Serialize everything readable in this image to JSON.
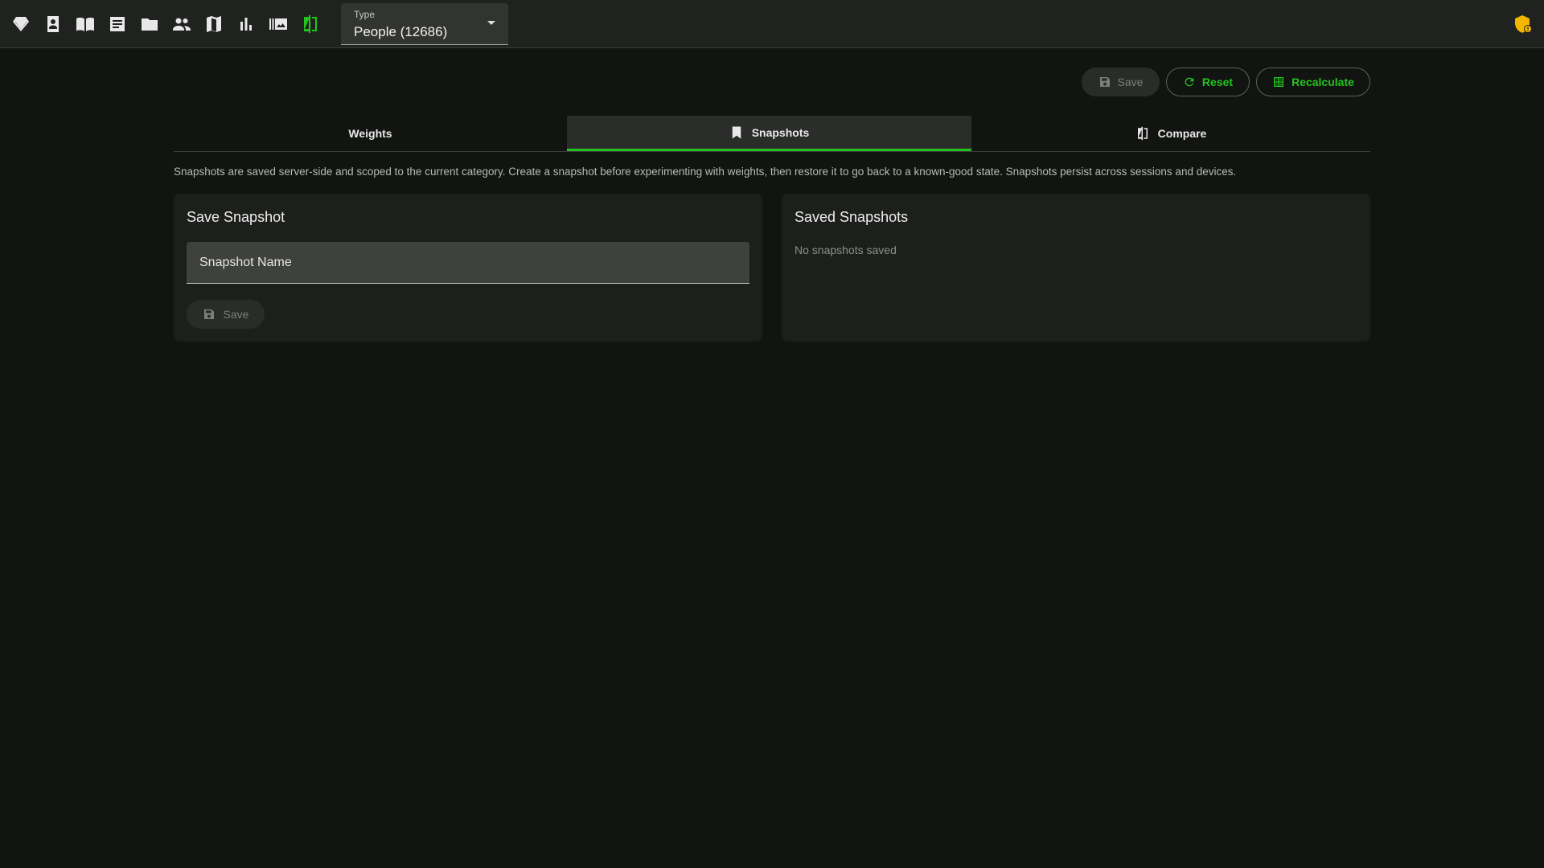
{
  "nav": {
    "icons": [
      "gem-icon",
      "contact-card-icon",
      "book-open-icon",
      "article-icon",
      "folder-icon",
      "people-icon",
      "map-icon",
      "bar-chart-icon",
      "gallery-icon",
      "compare-icon"
    ],
    "active_icon": "compare-icon",
    "type_select": {
      "label": "Type",
      "value": "People (12686)"
    },
    "status_icon": "shield-alert-icon"
  },
  "actions": {
    "save_label": "Save",
    "reset_label": "Reset",
    "recalculate_label": "Recalculate"
  },
  "tabs": [
    {
      "label": "Weights",
      "icon": "",
      "active": false
    },
    {
      "label": "Snapshots",
      "icon": "bookmark-icon",
      "active": true
    },
    {
      "label": "Compare",
      "icon": "compare-icon",
      "active": false
    }
  ],
  "description": "Snapshots are saved server-side and scoped to the current category. Create a snapshot before experimenting with weights, then restore it to go back to a known-good state. Snapshots persist across sessions and devices.",
  "save_snapshot": {
    "title": "Save Snapshot",
    "input_placeholder": "Snapshot Name",
    "input_value": "",
    "save_label": "Save"
  },
  "saved_snapshots": {
    "title": "Saved Snapshots",
    "empty_text": "No snapshots saved",
    "items": []
  },
  "colors": {
    "accent": "#22c51e",
    "background": "#121411",
    "topbar": "#202220",
    "card": "#1d1f1c",
    "warning": "#f5b400"
  }
}
